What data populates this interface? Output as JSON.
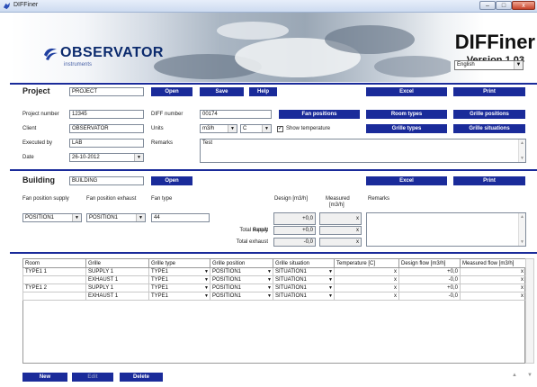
{
  "window": {
    "title": "DIFFiner",
    "min_glyph": "–",
    "max_glyph": "□",
    "close_glyph": "x"
  },
  "banner": {
    "logo_text": "OBSERVATOR",
    "logo_sub": "instruments",
    "app_name": "DIFFiner",
    "version": "Version 1.03",
    "language": "English"
  },
  "project": {
    "title": "Project",
    "name": "PROJECT",
    "open": "Open",
    "save": "Save",
    "help": "Help",
    "excel": "Excel",
    "print": "Print",
    "number_label": "Project number",
    "number": "12345",
    "client_label": "Client",
    "client": "OBSERVATOR",
    "executed_label": "Executed by",
    "executed": "LAB",
    "date_label": "Date",
    "date": "26-10-2012",
    "diff_label": "DIFF number",
    "diff": "00174",
    "units_label": "Units",
    "unit_flow": "m3/h",
    "unit_temp": "C",
    "remarks_label": "Remarks",
    "remarks": "Test",
    "show_temp": "Show temperature",
    "show_temp_checked": true,
    "fan_positions": "Fan positions",
    "room_types": "Room types",
    "grille_positions": "Grille positions",
    "grille_types": "Grille types",
    "grille_situations": "Grille situations"
  },
  "building": {
    "title": "Building",
    "name": "BUILDING",
    "open": "Open",
    "excel": "Excel",
    "print": "Print",
    "fan_supply_label": "Fan position supply",
    "fan_exhaust_label": "Fan position exhaust",
    "fan_type_label": "Fan type",
    "design_label": "Design [m3/h]",
    "measured_label": "Measured",
    "measured_unit": "[m3/h]",
    "remarks_label": "Remarks",
    "fan_supply": "POSITION1",
    "fan_exhaust": "POSITION1",
    "fan_type": "44",
    "result_label": "Result",
    "result_design": "+0,0",
    "result_measured": "x",
    "total_supply_label": "Total supply",
    "total_supply_design": "+0,0",
    "total_supply_measured": "x",
    "total_exhaust_label": "Total exhaust",
    "total_exhaust_design": "-0,0",
    "total_exhaust_measured": "x"
  },
  "grid": {
    "headers": [
      "Room",
      "Grille",
      "Grille type",
      "Grille position",
      "Grille situation",
      "Temperature [C]",
      "Design flow [m3/h]",
      "Measured flow [m3/h]"
    ],
    "rows": [
      [
        "TYPE1 1",
        "SUPPLY 1",
        "TYPE1",
        "POSITION1",
        "SITUATION1",
        "x",
        "+0,0",
        "x"
      ],
      [
        "",
        "EXHAUST 1",
        "TYPE1",
        "POSITION1",
        "SITUATION1",
        "x",
        "-0,0",
        "x"
      ],
      [
        "TYPE1 2",
        "SUPPLY 1",
        "TYPE1",
        "POSITION1",
        "SITUATION1",
        "x",
        "+0,0",
        "x"
      ],
      [
        "",
        "EXHAUST 1",
        "TYPE1",
        "POSITION1",
        "SITUATION1",
        "x",
        "-0,0",
        "x"
      ]
    ]
  },
  "footer": {
    "new": "New",
    "edit": "Edit",
    "delete": "Delete"
  },
  "colors": {
    "accent": "#1a2b9a",
    "logo": "#0b2a6d"
  }
}
